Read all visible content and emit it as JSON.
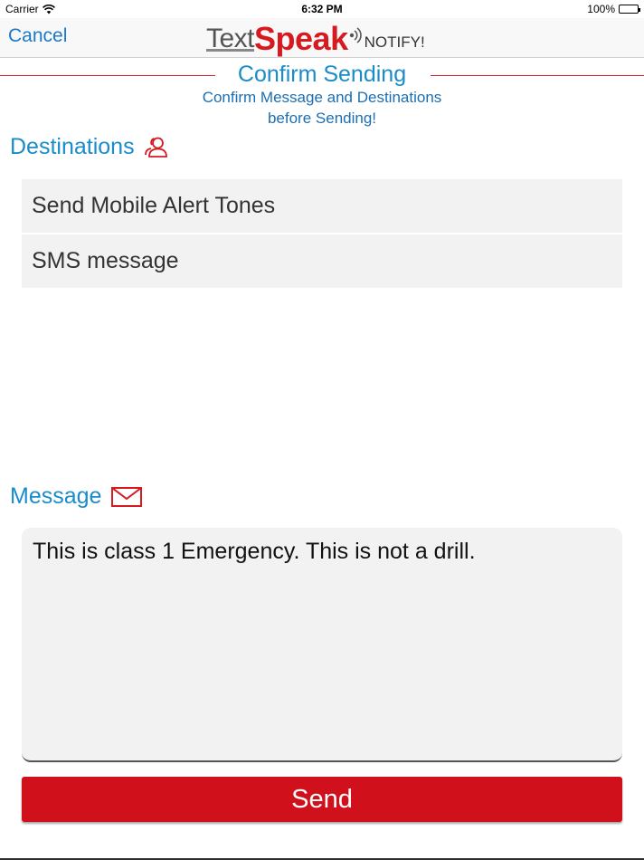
{
  "status_bar": {
    "carrier": "Carrier",
    "time": "6:32 PM",
    "battery": "100%"
  },
  "nav": {
    "cancel_label": "Cancel",
    "logo": {
      "text_part": "Text",
      "speak_part": "Speak",
      "notify_part": "NOTIFY!"
    }
  },
  "header": {
    "title": "Confirm Sending",
    "subtitle_line1": "Confirm Message and Destinations",
    "subtitle_line2": "before Sending!"
  },
  "destinations": {
    "label": "Destinations",
    "icon": "people-icon",
    "items": [
      {
        "label": "Send Mobile Alert Tones"
      },
      {
        "label": "SMS message"
      }
    ]
  },
  "message": {
    "label": "Message",
    "icon": "envelope-icon",
    "text": "This is class 1 Emergency. This is not a drill."
  },
  "send_button": {
    "label": "Send"
  },
  "colors": {
    "accent_blue": "#1a8cc9",
    "brand_red": "#d0101a",
    "cancel_blue": "#1c78c8"
  }
}
